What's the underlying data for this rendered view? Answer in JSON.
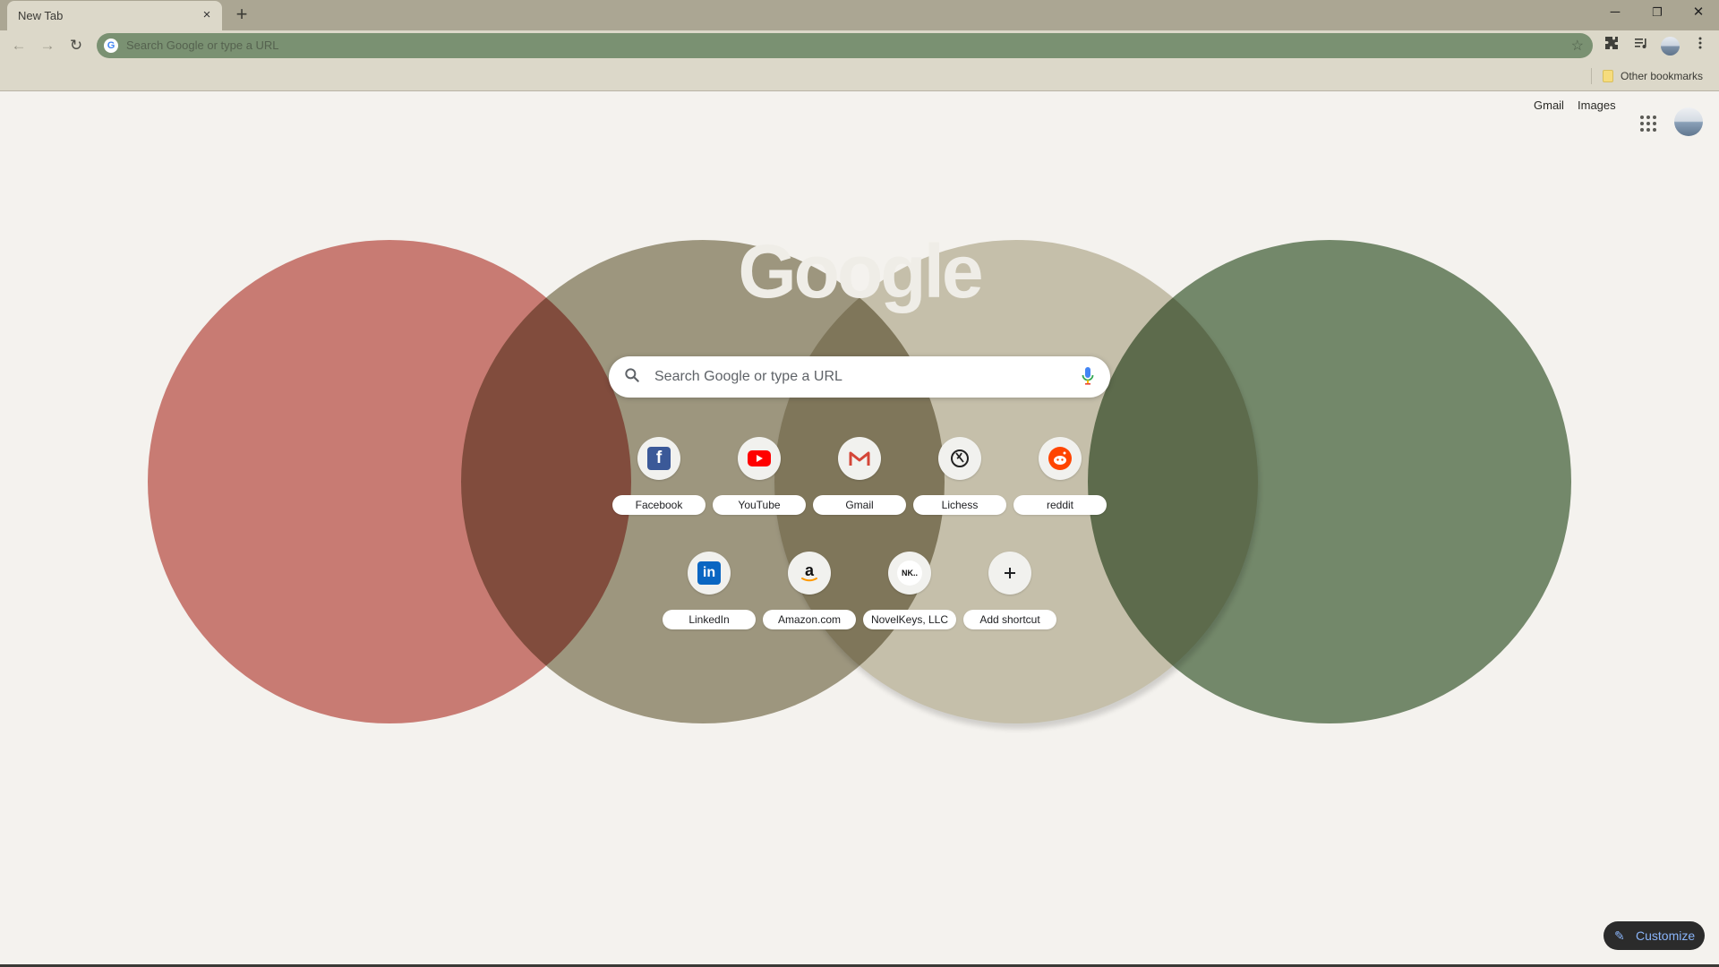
{
  "browser": {
    "tab_title": "New Tab",
    "tab_close": "×",
    "new_tab": "+",
    "window_controls": {
      "minimize": "─",
      "restore": "❐",
      "close": "✕"
    },
    "nav": {
      "back": "←",
      "forward": "→",
      "reload": "↻"
    },
    "omnibox_placeholder": "Search Google or type a URL",
    "bookmarks_other": "Other bookmarks"
  },
  "header_links": {
    "gmail": "Gmail",
    "images": "Images"
  },
  "logo_text": "Google",
  "search": {
    "placeholder": "Search Google or type a URL"
  },
  "shortcuts_row1": [
    {
      "label": "Facebook",
      "icon": "facebook-icon"
    },
    {
      "label": "YouTube",
      "icon": "youtube-icon"
    },
    {
      "label": "Gmail",
      "icon": "gmail-icon"
    },
    {
      "label": "Lichess",
      "icon": "lichess-icon"
    },
    {
      "label": "reddit",
      "icon": "reddit-icon"
    }
  ],
  "shortcuts_row2": [
    {
      "label": "LinkedIn",
      "icon": "linkedin-icon"
    },
    {
      "label": "Amazon.com",
      "icon": "amazon-icon"
    },
    {
      "label": "NovelKeys, LLC",
      "icon": "novelkeys-icon",
      "icon_text": "NK.."
    },
    {
      "label": "Add shortcut",
      "icon": "add-icon"
    }
  ],
  "customize_label": "Customize",
  "theme_colors": {
    "circle_red": "#c87b73",
    "circle_taupe": "#a49e87",
    "circle_beige": "#cec9b6",
    "circle_green": "#788f71",
    "omnibox": "#7a9172",
    "frame": "#aba693"
  }
}
